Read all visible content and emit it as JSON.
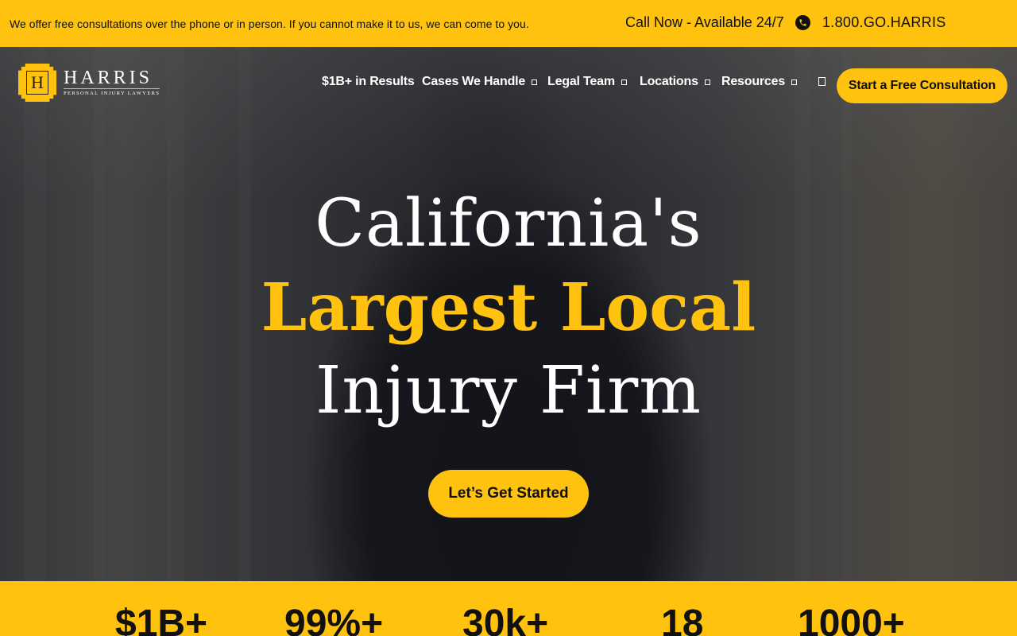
{
  "topbar": {
    "message": "We offer free consultations over the phone or in person. If you cannot make it to us, we can come to you.",
    "call_label": "Call Now - Available 24/7",
    "phone_icon": "phone-icon",
    "phone_number": "1.800.GO.HARRIS"
  },
  "logo": {
    "monogram": "H",
    "name": "HARRIS",
    "tagline": "PERSONAL INJURY LAWYERS"
  },
  "nav": {
    "items": [
      {
        "label": "$1B+ in Results",
        "dropdown": false
      },
      {
        "label": "Cases We Handle",
        "dropdown": true
      },
      {
        "label": "Legal Team",
        "dropdown": true
      },
      {
        "label": "Locations",
        "dropdown": true
      },
      {
        "label": "Resources",
        "dropdown": true
      }
    ],
    "search_icon": "search-icon",
    "cta_label": "Start a Free Consultation"
  },
  "hero": {
    "line1": "California's",
    "line2": "Largest Local",
    "line3": "Injury Firm",
    "cta_label": "Let’s Get Started"
  },
  "stats": [
    "$1B+",
    "99%+",
    "30k+",
    "18",
    "1000+"
  ],
  "colors": {
    "accent": "#ffc20e",
    "text_dark": "#111111",
    "text_light": "#ffffff"
  }
}
